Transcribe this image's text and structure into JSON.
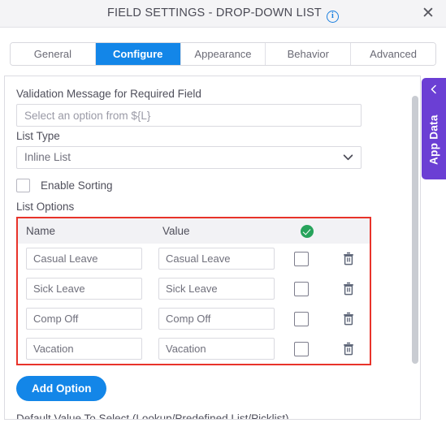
{
  "titlebar": {
    "title": "FIELD SETTINGS - DROP-DOWN LIST",
    "info_icon": "info-icon",
    "close_icon": "✕"
  },
  "tabs": [
    {
      "label": "General",
      "active": false
    },
    {
      "label": "Configure",
      "active": true
    },
    {
      "label": "Appearance",
      "active": false
    },
    {
      "label": "Behavior",
      "active": false
    },
    {
      "label": "Advanced",
      "active": false
    }
  ],
  "form": {
    "validation_label": "Validation Message for Required Field",
    "validation_value": "Select an option from ${L}",
    "validation_placeholder": "Select an option from ${L}",
    "list_type_label": "List Type",
    "list_type_value": "Inline List",
    "list_type_options": [
      "Inline List"
    ],
    "enable_sorting_label": "Enable Sorting",
    "enable_sorting_checked": false,
    "list_options_label": "List Options",
    "add_option_label": "Add Option",
    "default_value_label": "Default Value To Select (Lookup/Predefined List/Picklist)"
  },
  "options_table": {
    "columns": [
      "Name",
      "Value"
    ],
    "selected_marker_icon": "check-circle-icon",
    "rows": [
      {
        "name": "Casual Leave",
        "value": "Casual Leave",
        "checked": false
      },
      {
        "name": "Sick Leave",
        "value": "Sick Leave",
        "checked": false
      },
      {
        "name": "Comp Off",
        "value": "Comp Off",
        "checked": false
      },
      {
        "name": "Vacation",
        "value": "Vacation",
        "checked": false
      }
    ]
  },
  "app_data_panel": {
    "label": "App Data",
    "collapse_icon": "chevron-left-icon"
  },
  "colors": {
    "accent_blue": "#1386e8",
    "purple": "#6b3fd4",
    "green": "#27a35b",
    "red_highlight": "#e8332a",
    "titlebar_bg": "#f4f4f6"
  }
}
